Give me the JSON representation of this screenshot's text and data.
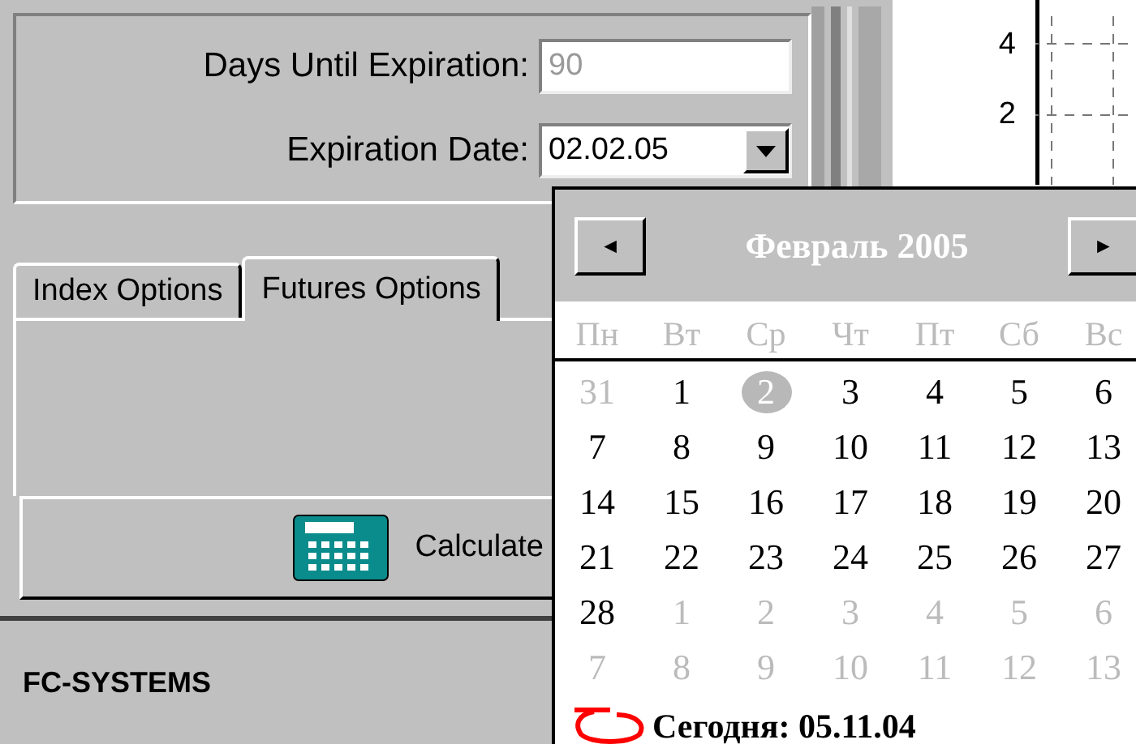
{
  "fields": [
    {
      "label": "Days Until Expiration:",
      "value": "90",
      "disabled": true,
      "kind": "text"
    },
    {
      "label": "Expiration Date:",
      "value": "02.02.05",
      "disabled": false,
      "kind": "dropdown"
    }
  ],
  "tabs": [
    {
      "label": "Index Options",
      "selected": false
    },
    {
      "label": "Futures Options",
      "selected": true
    }
  ],
  "calculate_button": {
    "label": "Calculate"
  },
  "status_bar": {
    "text": "FC-SYSTEMS"
  },
  "chart_axis": {
    "labels": [
      "4",
      "2"
    ]
  },
  "calendar": {
    "title": "Февраль 2005",
    "prev": "◄",
    "next": "►",
    "weekdays": [
      "Пн",
      "Вт",
      "Ср",
      "Чт",
      "Пт",
      "Сб",
      "Вс"
    ],
    "weeks": [
      [
        {
          "day": "31",
          "other_month": true,
          "selected": false
        },
        {
          "day": "1",
          "other_month": false,
          "selected": false
        },
        {
          "day": "2",
          "other_month": false,
          "selected": true
        },
        {
          "day": "3",
          "other_month": false,
          "selected": false
        },
        {
          "day": "4",
          "other_month": false,
          "selected": false
        },
        {
          "day": "5",
          "other_month": false,
          "selected": false
        },
        {
          "day": "6",
          "other_month": false,
          "selected": false
        }
      ],
      [
        {
          "day": "7",
          "other_month": false,
          "selected": false
        },
        {
          "day": "8",
          "other_month": false,
          "selected": false
        },
        {
          "day": "9",
          "other_month": false,
          "selected": false
        },
        {
          "day": "10",
          "other_month": false,
          "selected": false
        },
        {
          "day": "11",
          "other_month": false,
          "selected": false
        },
        {
          "day": "12",
          "other_month": false,
          "selected": false
        },
        {
          "day": "13",
          "other_month": false,
          "selected": false
        }
      ],
      [
        {
          "day": "14",
          "other_month": false,
          "selected": false
        },
        {
          "day": "15",
          "other_month": false,
          "selected": false
        },
        {
          "day": "16",
          "other_month": false,
          "selected": false
        },
        {
          "day": "17",
          "other_month": false,
          "selected": false
        },
        {
          "day": "18",
          "other_month": false,
          "selected": false
        },
        {
          "day": "19",
          "other_month": false,
          "selected": false
        },
        {
          "day": "20",
          "other_month": false,
          "selected": false
        }
      ],
      [
        {
          "day": "21",
          "other_month": false,
          "selected": false
        },
        {
          "day": "22",
          "other_month": false,
          "selected": false
        },
        {
          "day": "23",
          "other_month": false,
          "selected": false
        },
        {
          "day": "24",
          "other_month": false,
          "selected": false
        },
        {
          "day": "25",
          "other_month": false,
          "selected": false
        },
        {
          "day": "26",
          "other_month": false,
          "selected": false
        },
        {
          "day": "27",
          "other_month": false,
          "selected": false
        }
      ],
      [
        {
          "day": "28",
          "other_month": false,
          "selected": false
        },
        {
          "day": "1",
          "other_month": true,
          "selected": false
        },
        {
          "day": "2",
          "other_month": true,
          "selected": false
        },
        {
          "day": "3",
          "other_month": true,
          "selected": false
        },
        {
          "day": "4",
          "other_month": true,
          "selected": false
        },
        {
          "day": "5",
          "other_month": true,
          "selected": false
        },
        {
          "day": "6",
          "other_month": true,
          "selected": false
        }
      ],
      [
        {
          "day": "7",
          "other_month": true,
          "selected": false
        },
        {
          "day": "8",
          "other_month": true,
          "selected": false
        },
        {
          "day": "9",
          "other_month": true,
          "selected": false
        },
        {
          "day": "10",
          "other_month": true,
          "selected": false
        },
        {
          "day": "11",
          "other_month": true,
          "selected": false
        },
        {
          "day": "12",
          "other_month": true,
          "selected": false
        },
        {
          "day": "13",
          "other_month": true,
          "selected": false
        }
      ]
    ],
    "today": "Сегодня: 05.11.04"
  }
}
